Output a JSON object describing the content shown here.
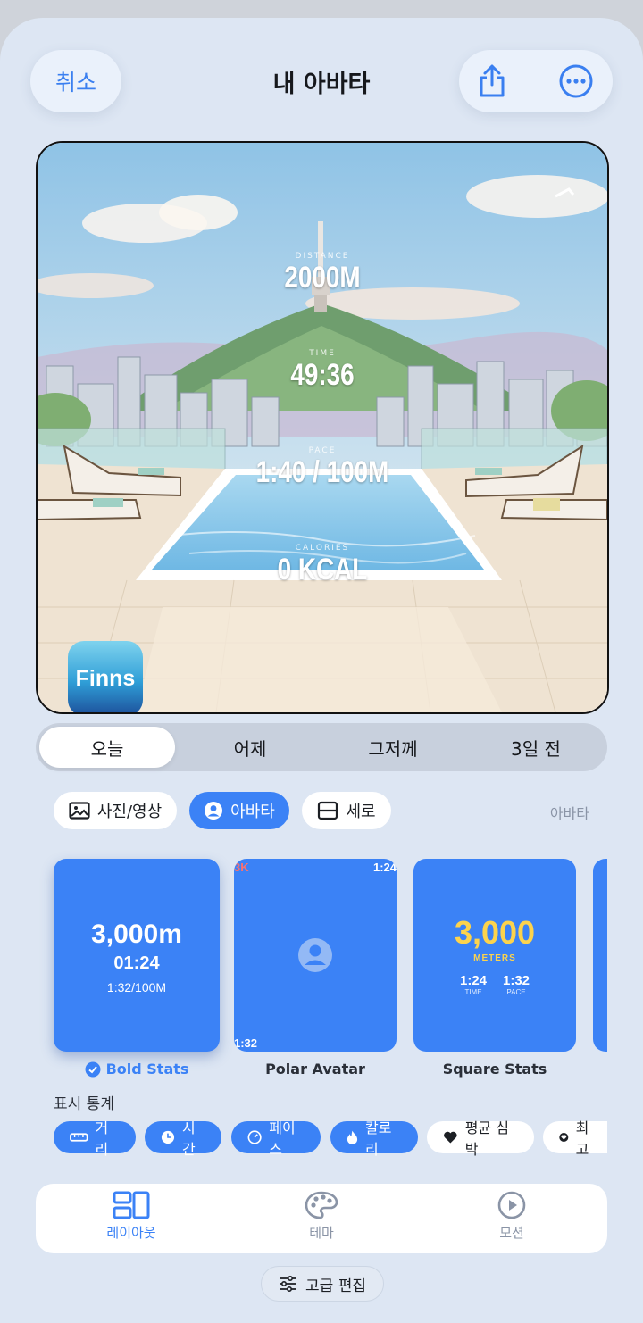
{
  "header": {
    "cancel_label": "취소",
    "title": "내 아바타"
  },
  "preview": {
    "stats": [
      {
        "label": "DISTANCE",
        "value": "2000M"
      },
      {
        "label": "TIME",
        "value": "49:36"
      },
      {
        "label": "PACE",
        "value": "1:40 / 100M"
      },
      {
        "label": "CALORIES",
        "value": "0 KCAL"
      }
    ],
    "app_logo": "Finns"
  },
  "days": [
    "오늘",
    "어제",
    "그저께",
    "3일 전"
  ],
  "mode_chips": [
    {
      "label": "사진/영상",
      "icon": "image-icon",
      "active": false
    },
    {
      "label": "아바타",
      "icon": "avatar-icon",
      "active": true
    },
    {
      "label": "세로",
      "icon": "layout-icon",
      "active": false
    }
  ],
  "mode_label": "아바타",
  "layouts": [
    {
      "name": "Bold Stats",
      "selected": true,
      "distance": "3,000m",
      "time": "01:24",
      "pace": "1:32/100M"
    },
    {
      "name": "Polar Avatar",
      "selected": false,
      "top_left": "3K",
      "top_right": "1:24",
      "bottom_left": "1:32"
    },
    {
      "name": "Square Stats",
      "selected": false,
      "big": "3,000",
      "unit": "METERS",
      "time": "1:24",
      "time_label": "TIME",
      "pace": "1:32",
      "pace_label": "PACE"
    }
  ],
  "stats_section_title": "표시 통계",
  "stat_chips": [
    {
      "label": "거리",
      "icon": "ruler-icon",
      "active": true
    },
    {
      "label": "시간",
      "icon": "clock-icon",
      "active": true
    },
    {
      "label": "페이스",
      "icon": "gauge-icon",
      "active": true
    },
    {
      "label": "칼로리",
      "icon": "flame-icon",
      "active": true
    },
    {
      "label": "평균 심박",
      "icon": "heart-icon",
      "active": false
    },
    {
      "label": "최고",
      "icon": "heart-badge-icon",
      "active": false
    }
  ],
  "tabs": [
    {
      "label": "레이아웃",
      "icon": "layout-icon",
      "active": true
    },
    {
      "label": "테마",
      "icon": "palette-icon",
      "active": false
    },
    {
      "label": "모션",
      "icon": "play-icon",
      "active": false
    }
  ],
  "advanced_edit_label": "고급 편집",
  "colors": {
    "accent": "#3b82f6",
    "background": "#dde6f3",
    "yellow": "#fcd34d"
  }
}
